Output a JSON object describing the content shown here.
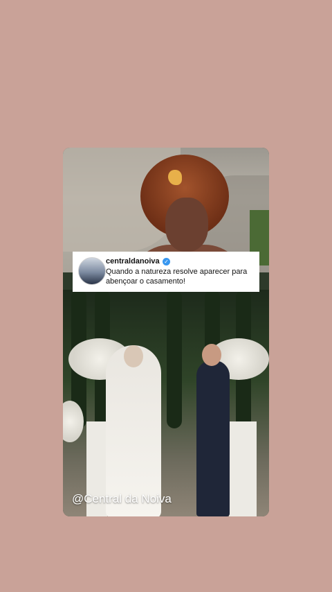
{
  "post": {
    "account_name": "centraldanoiva",
    "verified_icon": "verified-checkmark-icon",
    "caption": "Quando a natureza resolve aparecer para abençoar o casamento!"
  },
  "watermark": "@Central da Noiva",
  "colors": {
    "background": "#c9a298",
    "verified_badge": "#3897f0"
  }
}
